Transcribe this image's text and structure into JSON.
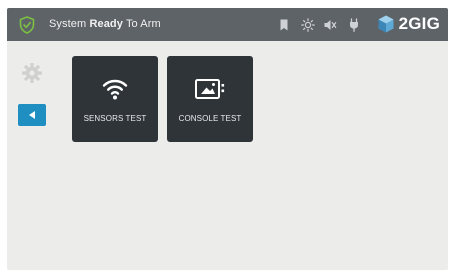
{
  "status_bar": {
    "status_prefix": "System",
    "status_strong": "Ready",
    "status_suffix": "To Arm",
    "brand_name": "2GIG",
    "icons": [
      "shield-check-icon",
      "bookmark-icon",
      "brightness-icon",
      "mute-icon",
      "power-plug-icon",
      "2gig-logo-icon"
    ]
  },
  "sidebar": {
    "icons": [
      "gear-icon",
      "back-arrow-icon"
    ]
  },
  "tiles": [
    {
      "label": "SENSORS TEST",
      "icon": "wifi-icon"
    },
    {
      "label": "CONSOLE TEST",
      "icon": "console-panel-icon"
    }
  ],
  "colors": {
    "status_bar": "#5e6368",
    "shield_accent": "#7cc142",
    "tile_background": "#2f3439",
    "back_button": "#1f8fc2",
    "screen_background": "#ececea"
  }
}
